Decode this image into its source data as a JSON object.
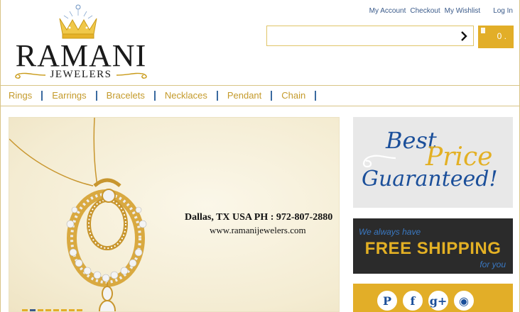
{
  "brand": {
    "name": "RAMANI",
    "sub": "JEWELERS"
  },
  "top_links": {
    "account": "My Account",
    "checkout": "Checkout",
    "wishlist": "My Wishlist",
    "login": "Log In"
  },
  "search": {
    "value": "",
    "placeholder": ""
  },
  "cart": {
    "count": "0",
    "suffix": "."
  },
  "nav": [
    "Rings",
    "Earrings",
    "Bracelets",
    "Necklaces",
    "Pendant",
    "Chain"
  ],
  "hero": {
    "line1": "Dallas, TX USA     PH : 972-807-2880",
    "line2": "www.ramanijewelers.com",
    "slide_count": 8,
    "active_slide": 1
  },
  "best_price": {
    "w1": "Best",
    "w2": "Price",
    "w3": "Guaranteed!"
  },
  "shipping": {
    "top": "We always have",
    "main": "FREE SHIPPING",
    "bottom": "for you"
  },
  "social": {
    "icons": [
      "pinterest-icon",
      "facebook-icon",
      "googleplus-icon",
      "rss-icon"
    ],
    "glyphs": [
      "P",
      "f",
      "g+",
      "◉"
    ]
  },
  "colors": {
    "gold": "#e2ae28",
    "nav_text": "#c49a2a",
    "blue": "#1b4f9a",
    "dark": "#2b2b2b"
  }
}
